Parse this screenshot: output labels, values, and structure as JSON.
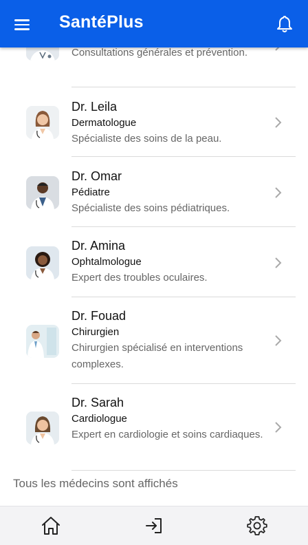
{
  "app": {
    "title": "SantéPlus"
  },
  "colors": {
    "primary": "#0a5fe8"
  },
  "header": {
    "menu_icon": "menu-icon",
    "notification_icon": "bell-icon"
  },
  "doctors": [
    {
      "name": "",
      "specialty": "",
      "description": "Consultations générales et prévention."
    },
    {
      "name": "Dr. Leila",
      "specialty": "Dermatologue",
      "description": "Spécialiste des soins de la peau."
    },
    {
      "name": "Dr. Omar",
      "specialty": "Pédiatre",
      "description": "Spécialiste des soins pédiatriques."
    },
    {
      "name": "Dr. Amina",
      "specialty": "Ophtalmologue",
      "description": "Expert des troubles oculaires."
    },
    {
      "name": "Dr. Fouad",
      "specialty": "Chirurgien",
      "description": "Chirurgien spécialisé en interventions complexes."
    },
    {
      "name": "Dr. Sarah",
      "specialty": "Cardiologue",
      "description": "Expert en cardiologie et soins cardiaques."
    }
  ],
  "footer": {
    "note": "Tous les médecins sont affichés"
  },
  "bottom_nav": {
    "home_icon": "home-icon",
    "login_icon": "login-icon",
    "settings_icon": "settings-icon"
  }
}
